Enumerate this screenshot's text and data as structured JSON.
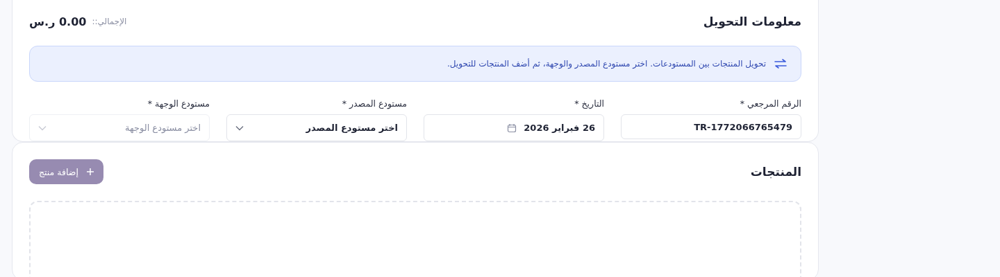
{
  "transfer_info": {
    "title": "معلومات التحويل",
    "total_label": "الإجمالي::",
    "total_value": "0.00 ر.س",
    "notice": "تحويل المنتجات بين المستودعات. اختر مستودع المصدر والوجهة، ثم أضف المنتجات للتحويل.",
    "fields": [
      {
        "kind": "text",
        "label": "الرقم المرجعي *",
        "value": "TR-1772066765479",
        "disabled": false
      },
      {
        "kind": "date",
        "label": "التاريخ *",
        "value": "26 فبراير 2026",
        "disabled": false
      },
      {
        "kind": "select",
        "label": "مستودع المصدر *",
        "value": "اختر مستودع المصدر",
        "disabled": false
      },
      {
        "kind": "select",
        "label": "مستودع الوجهة *",
        "placeholder": "اختر مستودع الوجهة",
        "disabled": true
      }
    ]
  },
  "products": {
    "title": "المنتجات",
    "add_button": {
      "label": "إضافة منتج",
      "disabled": true
    }
  }
}
